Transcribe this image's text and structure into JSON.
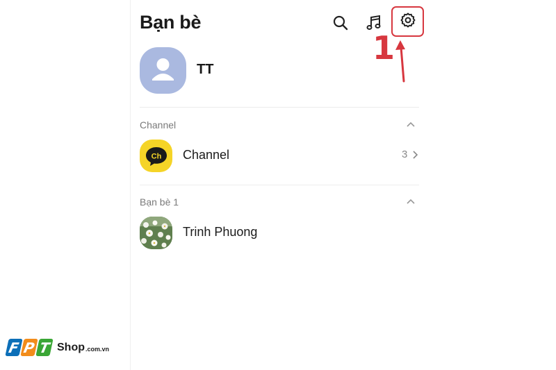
{
  "header": {
    "title": "Bạn bè",
    "icons": [
      "search-icon",
      "music-icon",
      "settings-icon"
    ]
  },
  "annotation": {
    "step_number": "1",
    "highlight_color": "#d7373f"
  },
  "profile": {
    "name": "TT",
    "avatar_color": "#aab9e0"
  },
  "sections": {
    "channel": {
      "header": "Channel",
      "item_label": "Channel",
      "icon_text": "Ch",
      "count": "3",
      "icon_color": "#f5d427"
    },
    "friends": {
      "header": "Bạn bè 1",
      "items": [
        {
          "name": "Trinh Phuong"
        }
      ]
    }
  },
  "watermark": {
    "letters": [
      "F",
      "P",
      "T"
    ],
    "letter_colors": [
      "#0c6fb8",
      "#f28c1b",
      "#3aa635"
    ],
    "brand": "Shop",
    "domain": ".com.vn"
  }
}
